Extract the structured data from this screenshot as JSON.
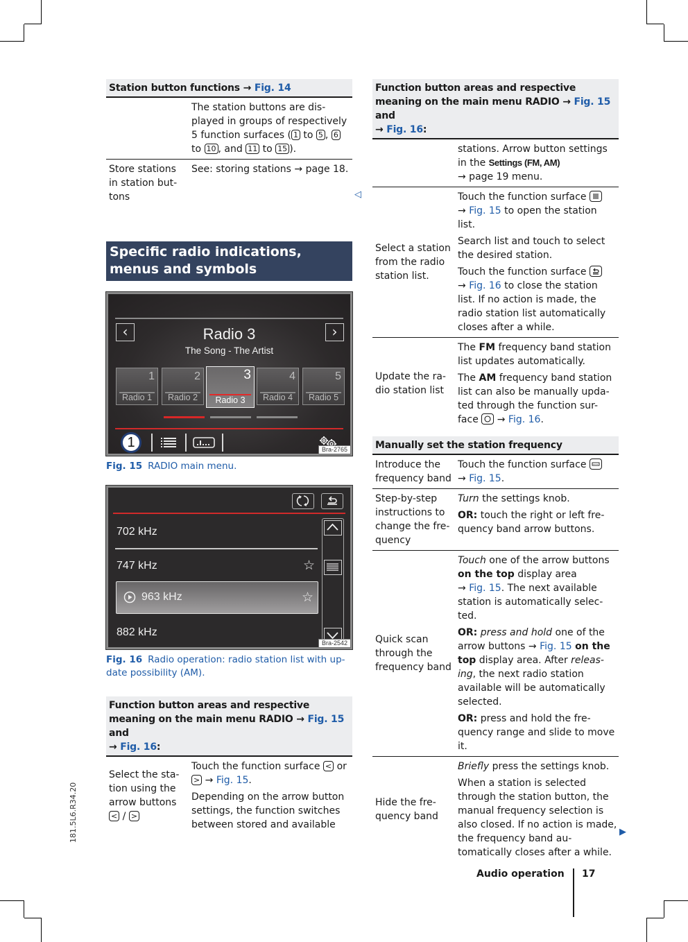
{
  "left_table_1": {
    "header_text": "Station button functions",
    "header_ref": "Fig. 14",
    "rows": [
      {
        "label": "",
        "desc_parts": [
          "The station buttons are dis-played in groups of respectively 5 function surfaces (",
          "1",
          " to ",
          "5",
          ", ",
          "6",
          " to ",
          "10",
          ", and ",
          "11",
          " to ",
          "15",
          ")."
        ]
      },
      {
        "label": "Store stations in station but-tons",
        "desc": "See: storing stations → page 18."
      }
    ],
    "continue_marker": "◁"
  },
  "section": {
    "title": "Specific radio indications, menus and symbols"
  },
  "fig15": {
    "station_name": "Radio 3",
    "now_playing": "The Song - The Artist",
    "presets": [
      {
        "num": "1",
        "label": "Radio 1",
        "active": false
      },
      {
        "num": "2",
        "label": "Radio 2",
        "active": false
      },
      {
        "num": "3",
        "label": "Radio 3",
        "active": true
      },
      {
        "num": "4",
        "label": "Radio 4",
        "active": false
      },
      {
        "num": "5",
        "label": "Radio 5",
        "active": false
      }
    ],
    "page_indicator": {
      "pages": 3,
      "current": 1
    },
    "callout": "1",
    "image_code": "Bra-2765",
    "caption_label": "Fig. 15",
    "caption_text": "RADIO main menu.",
    "colors": {
      "accent_red": "#d12a2a",
      "screen_bg": "#2b2829",
      "callout_ring": "#233e74"
    }
  },
  "fig16": {
    "stations": [
      {
        "freq": "702 kHz",
        "favorite_icon": false,
        "playing": false,
        "selected": false
      },
      {
        "freq": "747 kHz",
        "favorite_icon": true,
        "playing": false,
        "selected": false
      },
      {
        "freq": "963 kHz",
        "favorite_icon": true,
        "playing": true,
        "selected": true
      },
      {
        "freq": "882 kHz",
        "favorite_icon": false,
        "playing": false,
        "selected": false
      }
    ],
    "image_code": "Bra-2542",
    "caption_label": "Fig. 16",
    "caption_text": "Radio operation: radio station list with up-date possibility (AM)."
  },
  "left_table_2": {
    "header_text": "Function button areas and respective meaning on the main menu RADIO",
    "header_ref1": "Fig. 15",
    "header_and": "and",
    "header_ref2": "Fig. 16",
    "rows": [
      {
        "label": "Select the sta-tion using the arrow buttons",
        "label_keys": [
          "<",
          ">"
        ],
        "p1_pre": "Touch the function surface",
        "p1_key1": "<",
        "p1_or": "or",
        "p1_key2": ">",
        "p1_ref": "Fig. 15",
        "p2": "Depending on the arrow button settings, the function switches between stored and available"
      }
    ]
  },
  "right_table_1": {
    "header_text": "Function button areas and respective meaning on the main menu RADIO",
    "header_ref1": "Fig. 15",
    "header_and": "and",
    "header_ref2": "Fig. 16",
    "rows": [
      {
        "label": "",
        "desc_pre": "stations. Arrow button settings in the",
        "desc_menu": "Settings (FM, AM)",
        "desc_post": "→ page 19 menu."
      },
      {
        "label": "Select a station from the radio station list.",
        "p1_pre": "Touch the function surface",
        "p1_icon": "list-icon",
        "p1_ref": "Fig. 15",
        "p1_post": "to open the station list.",
        "p2": "Search list and touch to select the desired station.",
        "p3_pre": "Touch the function surface",
        "p3_icon": "back-icon",
        "p3_ref": "Fig. 16",
        "p3_post": "to close the station list. If no action is made, the radio station list automatically closes after a while."
      },
      {
        "label": "Update the ra-dio station list",
        "p1_pre": "The",
        "p1_bold": "FM",
        "p1_post": "frequency band station list updates automatically.",
        "p2_pre": "The",
        "p2_bold": "AM",
        "p2_post": "frequency band station list can also be manually upda-ted through the function sur-face",
        "p2_icon": "refresh-icon",
        "p2_ref": "Fig. 16"
      }
    ]
  },
  "right_table_2": {
    "header_text": "Manually set the station frequency",
    "rows": [
      {
        "label": "Introduce the frequency band",
        "p1_pre": "Touch the function surface",
        "p1_icon": "keyboard-icon",
        "p1_ref": "Fig. 15"
      },
      {
        "label": "Step-by-step instructions to change the fre-quency",
        "p1_italic": "Turn",
        "p1_post": "the settings knob.",
        "p2_bold": "OR:",
        "p2_post": "touch the right or left fre-quency band arrow buttons."
      },
      {
        "label": "Quick scan through the frequency band",
        "p1_italic": "Touch",
        "p1_mid": "one of the arrow buttons",
        "p1_bold": "on the top",
        "p1_mid2": "display area",
        "p1_ref": "Fig. 15",
        "p1_post": ". The next available station is automatically selec-ted.",
        "p2_bold": "OR:",
        "p2_italic": "press and hold",
        "p2_mid": "one of the arrow buttons",
        "p2_ref": "Fig. 15",
        "p2_bold2": "on the top",
        "p2_mid2": "display area. After",
        "p2_italic2": "releas-ing",
        "p2_post": ", the next radio station available will be automatically selected.",
        "p3_bold": "OR:",
        "p3_post": "press and hold the fre-quency range and slide to move it."
      },
      {
        "label": "Hide the fre-quency band",
        "p1_italic": "Briefly",
        "p1_post": "press the settings knob.",
        "p2": "When a station is selected through the station button, the manual frequency selection is also closed. If no action is made, the frequency band au-tomatically closes after a while."
      }
    ],
    "continue_marker": "▶"
  },
  "footer": {
    "section": "Audio operation",
    "page": "17",
    "doc_code": "181.5L6.R34.20"
  }
}
